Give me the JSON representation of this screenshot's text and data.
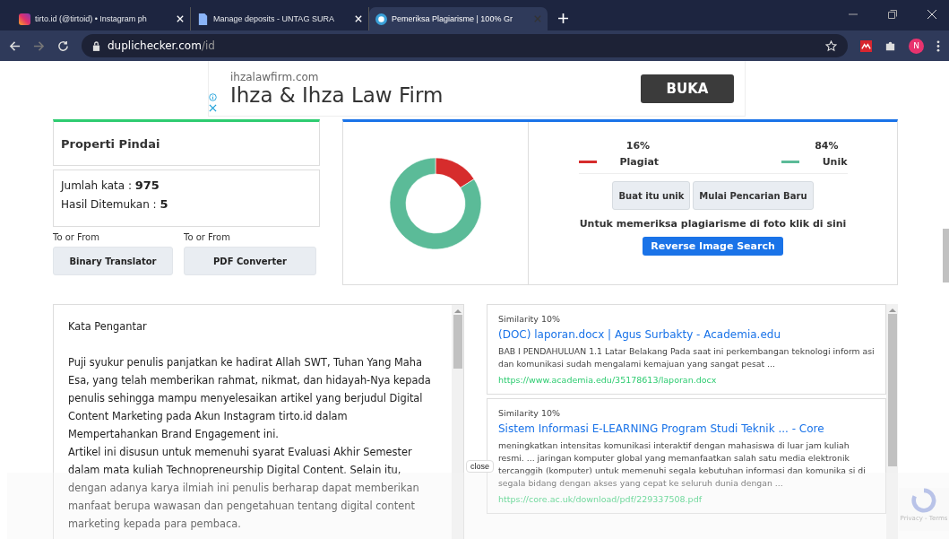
{
  "browser": {
    "tabs": [
      {
        "title": "tirto.id (@tirtoid) • Instagram ph",
        "selected": false
      },
      {
        "title": "Manage deposits - UNTAG SURA",
        "selected": false
      },
      {
        "title": "Pemeriksa Plagiarisme | 100% Gr",
        "selected": true
      }
    ],
    "avatar": "N",
    "url_host": "duplichecker.com",
    "url_path": "/id"
  },
  "ad": {
    "domain": "ihzalawfirm.com",
    "title": "Ihza & Ihza Law Firm",
    "button": "BUKA"
  },
  "scan": {
    "title": "Properti Pindai",
    "word_count_label": "Jumlah kata :",
    "word_count": "975",
    "found_label": "Hasil Ditemukan :",
    "found": "5",
    "tools": [
      {
        "caption": "To or From",
        "button": "Binary Translator"
      },
      {
        "caption": "To or From",
        "button": "PDF Converter"
      }
    ]
  },
  "result": {
    "chart_data": {
      "type": "donut",
      "values": [
        16,
        84
      ],
      "colors": [
        "#d62c2c",
        "#5bbb98"
      ]
    },
    "legend": [
      {
        "percent": "16%",
        "label": "Plagiat",
        "color": "#d62c2c"
      },
      {
        "percent": "84%",
        "label": "Unik",
        "color": "#5bbb98"
      }
    ],
    "buttons": [
      "Buat itu unik",
      "Mulai Pencarian Baru"
    ],
    "image_note": "Untuk memeriksa plagiarisme di foto klik di sini",
    "image_button": "Reverse Image Search"
  },
  "document": {
    "lines": [
      "Kata Pengantar",
      "Puji syukur penulis panjatkan ke hadirat Allah SWT, Tuhan Yang Maha Esa, yang telah memberikan rahmat, nikmat, dan hidayah-Nya kepada penulis sehingga mampu menyelesaikan artikel yang berjudul Digital Content Marketing pada Akun Instagram tirto.id dalam Mempertahankan Brand Engagement ini.",
      "Artikel ini disusun untuk memenuhi syarat Evaluasi Akhir Semester dalam mata kuliah Technopreneurship Digital Content. Selain itu, dengan adanya karya ilmiah ini penulis berharap dapat memberikan manfaat berupa wawasan dan pengetahuan tentang digital content marketing kepada para pembaca."
    ]
  },
  "matches": [
    {
      "similarity": "Similarity 10%",
      "title": "(DOC) laporan.docx | Agus Surbakty - Academia.edu",
      "snippet": "BAB I PENDAHULUAN 1.1 Latar Belakang Pada saat ini perkembangan teknologi inform asi dan komunikasi sudah mengalami kemajuan yang sangat pesat ...",
      "url": "https://www.academia.edu/35178613/laporan.docx"
    },
    {
      "similarity": "Similarity 10%",
      "title": "Sistem Informasi E-LEARNING Program Studi Teknik ... - Core",
      "snippet": "meningkatkan intensitas komunikasi interaktif dengan mahasiswa di luar jam kuliah resmi. ... jaringan komputer global yang memanfaatkan salah satu media elektronik tercanggih (komputer) untuk memenuhi segala kebutuhan informasi dan komunika si di segala bidang dengan akses yang cepat ke seluruh dunia dengan ...",
      "url": "https://core.ac.uk/download/pdf/229337508.pdf"
    }
  ],
  "overlay": {
    "close": "close",
    "recaptcha": "Privacy - Terms"
  }
}
